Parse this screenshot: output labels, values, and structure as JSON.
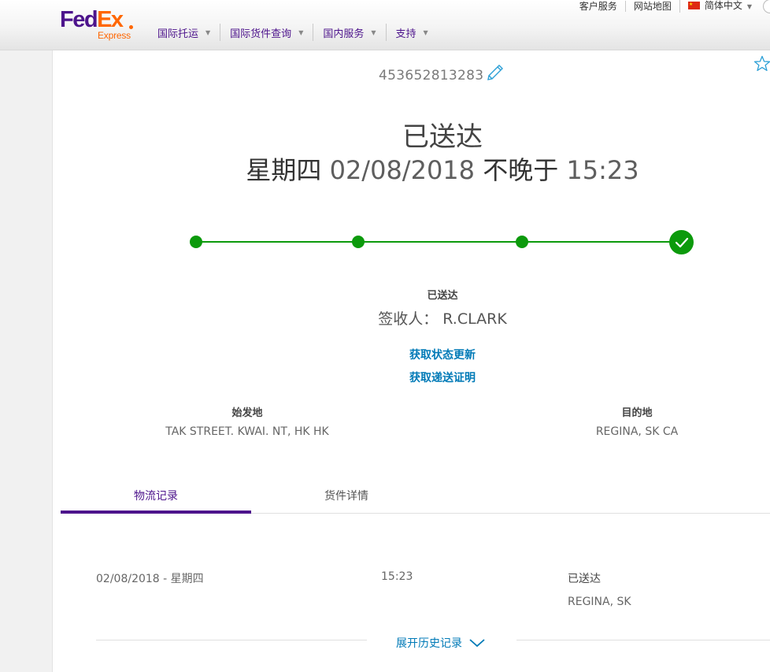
{
  "header": {
    "logo": {
      "fed": "Fed",
      "ex": "Ex",
      "express": "Express"
    },
    "nav": [
      {
        "label": "国际托运"
      },
      {
        "label": "国际货件查询"
      },
      {
        "label": "国内服务"
      },
      {
        "label": "支持"
      }
    ],
    "utility": {
      "customer_service": "客户服务",
      "site_map": "网站地图",
      "language": "简体中文"
    }
  },
  "shipment": {
    "tracking_number": "453652813283",
    "status": "已送达",
    "date_day": "星期四",
    "date": "02/08/2018",
    "by_label": "不晚于",
    "time": "15:23",
    "progress": {
      "steps": 4,
      "completed": 4
    },
    "status_label": "已送达",
    "signed_label": "签收人：",
    "signed_by": "R.CLARK",
    "get_updates": "获取状态更新",
    "get_proof": "获取递送证明",
    "origin_label": "始发地",
    "origin": "TAK STREET. KWAI. NT, HK HK",
    "destination_label": "目的地",
    "destination": "REGINA, SK CA"
  },
  "tabs": [
    {
      "label": "物流记录",
      "active": true
    },
    {
      "label": "货件详情",
      "active": false
    }
  ],
  "events": [
    {
      "date": "02/08/2018 - 星期四",
      "time": "15:23",
      "status": "已送达",
      "location": "REGINA, SK"
    }
  ],
  "expand_history": "展开历史记录",
  "colors": {
    "fedex_purple": "#4d148c",
    "fedex_orange": "#ff6600",
    "progress_green": "#0c9a0c",
    "link_blue": "#007ab7"
  },
  "icons": [
    "edit-pencil-icon",
    "favorite-star-icon",
    "checkmark-icon",
    "chevron-down-icon",
    "china-flag-icon"
  ]
}
